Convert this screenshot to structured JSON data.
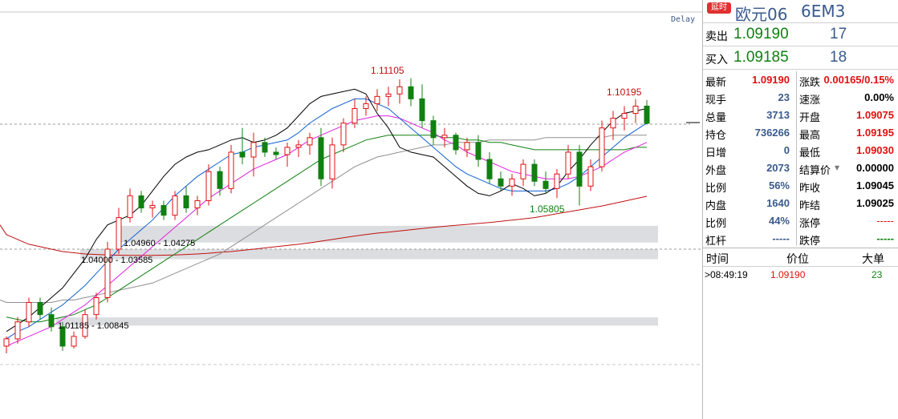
{
  "chart": {
    "delay_label": "Delay",
    "annotations": {
      "high1": "1.11105",
      "high2": "1.10195",
      "low1": "1.05805"
    },
    "zones": [
      {
        "label": "1.04960 - 1.04275",
        "upper": 1.0496,
        "lower": 1.04275
      },
      {
        "label": "1.04000 - 1.03585",
        "upper": 1.04,
        "lower": 1.03585
      },
      {
        "label": "1.01185 - 1.00845",
        "upper": 1.01185,
        "lower": 1.00845
      }
    ],
    "colors": {
      "up": "#e01010",
      "down": "#108010",
      "ma5": "#000000",
      "ma10": "#1060d0",
      "ma20": "#e020e0",
      "ma60": "#108010",
      "ma120": "#909090",
      "ma250": "#c01010"
    }
  },
  "chart_data": {
    "type": "candlestick",
    "price_levels": {
      "last": 1.0919,
      "previous_settle": 1.09025
    },
    "series": [
      {
        "name": "MA5",
        "values": [
          1.006,
          1.009,
          1.012,
          1.016,
          1.02,
          1.024,
          1.03,
          1.036,
          1.044,
          1.05,
          1.052,
          1.054,
          1.058,
          1.064,
          1.07,
          1.075,
          1.078,
          1.08,
          1.081,
          1.083,
          1.085,
          1.086,
          1.084,
          1.085,
          1.087,
          1.09,
          1.095,
          1.1,
          1.103,
          1.104,
          1.105,
          1.106,
          1.104,
          1.096,
          1.09,
          1.082,
          1.08,
          1.079,
          1.078,
          1.074,
          1.07,
          1.066,
          1.063,
          1.062,
          1.064,
          1.067,
          1.065,
          1.062,
          1.063,
          1.066,
          1.072,
          1.077,
          1.083,
          1.088,
          1.093,
          1.096,
          1.097,
          1.098
        ]
      },
      {
        "name": "MA10",
        "values": [
          1.003,
          1.006,
          1.008,
          1.011,
          1.014,
          1.017,
          1.021,
          1.025,
          1.03,
          1.035,
          1.04,
          1.044,
          1.048,
          1.052,
          1.057,
          1.062,
          1.066,
          1.07,
          1.073,
          1.076,
          1.079,
          1.08,
          1.082,
          1.083,
          1.084,
          1.085,
          1.088,
          1.092,
          1.095,
          1.098,
          1.1,
          1.102,
          1.102,
          1.1,
          1.098,
          1.094,
          1.09,
          1.086,
          1.082,
          1.078,
          1.074,
          1.071,
          1.069,
          1.067,
          1.065,
          1.064,
          1.064,
          1.064,
          1.064,
          1.065,
          1.067,
          1.07,
          1.074,
          1.078,
          1.082,
          1.086,
          1.089,
          1.092
        ]
      },
      {
        "name": "MA20",
        "values": [
          1.0,
          1.002,
          1.004,
          1.006,
          1.008,
          1.011,
          1.014,
          1.017,
          1.021,
          1.025,
          1.029,
          1.033,
          1.037,
          1.041,
          1.045,
          1.049,
          1.053,
          1.057,
          1.061,
          1.064,
          1.067,
          1.07,
          1.073,
          1.075,
          1.077,
          1.079,
          1.082,
          1.085,
          1.087,
          1.089,
          1.091,
          1.093,
          1.094,
          1.095,
          1.095,
          1.094,
          1.092,
          1.09,
          1.088,
          1.085,
          1.083,
          1.08,
          1.078,
          1.076,
          1.074,
          1.072,
          1.071,
          1.07,
          1.069,
          1.069,
          1.069,
          1.07,
          1.072,
          1.074,
          1.077,
          1.08,
          1.082,
          1.084
        ]
      },
      {
        "name": "MA60",
        "values": [
          1.012,
          1.011,
          1.01,
          1.01,
          1.011,
          1.012,
          1.013,
          1.015,
          1.017,
          1.02,
          1.023,
          1.026,
          1.029,
          1.032,
          1.035,
          1.038,
          1.041,
          1.044,
          1.047,
          1.05,
          1.053,
          1.056,
          1.059,
          1.062,
          1.065,
          1.068,
          1.071,
          1.074,
          1.077,
          1.079,
          1.081,
          1.083,
          1.085,
          1.086,
          1.087,
          1.087,
          1.087,
          1.087,
          1.087,
          1.086,
          1.086,
          1.085,
          1.085,
          1.084,
          1.084,
          1.083,
          1.082,
          1.081,
          1.081,
          1.081,
          1.081,
          1.081,
          1.081,
          1.081,
          1.081,
          1.081,
          1.082,
          1.082
        ]
      },
      {
        "name": "MA120",
        "values": [
          1.018,
          1.018,
          1.018,
          1.018,
          1.018,
          1.019,
          1.019,
          1.02,
          1.021,
          1.022,
          1.023,
          1.024,
          1.025,
          1.026,
          1.028,
          1.03,
          1.032,
          1.034,
          1.036,
          1.038,
          1.041,
          1.044,
          1.047,
          1.05,
          1.053,
          1.056,
          1.059,
          1.062,
          1.065,
          1.068,
          1.071,
          1.074,
          1.076,
          1.078,
          1.079,
          1.08,
          1.081,
          1.082,
          1.083,
          1.083,
          1.084,
          1.084,
          1.084,
          1.085,
          1.085,
          1.085,
          1.085,
          1.085,
          1.086,
          1.086,
          1.086,
          1.086,
          1.086,
          1.086,
          1.087,
          1.087,
          1.087,
          1.087
        ]
      },
      {
        "name": "MA250",
        "values": [
          1.046,
          1.044,
          1.042,
          1.041,
          1.04,
          1.039,
          1.0385,
          1.038,
          1.0378,
          1.0376,
          1.0375,
          1.0374,
          1.0374,
          1.0374,
          1.0375,
          1.0376,
          1.0378,
          1.038,
          1.0383,
          1.0387,
          1.039,
          1.0395,
          1.04,
          1.0405,
          1.041,
          1.0415,
          1.042,
          1.0426,
          1.0433,
          1.044,
          1.0447,
          1.0454,
          1.046,
          1.0466,
          1.047,
          1.0475,
          1.048,
          1.0485,
          1.049,
          1.0494,
          1.0498,
          1.0502,
          1.0506,
          1.051,
          1.0515,
          1.052,
          1.0525,
          1.053,
          1.0538,
          1.0546,
          1.0554,
          1.0562,
          1.057,
          1.0578,
          1.0588,
          1.0598,
          1.0608,
          1.0618
        ]
      }
    ],
    "candles": [
      {
        "o": 1.0,
        "h": 1.004,
        "l": 0.997,
        "c": 1.003
      },
      {
        "o": 1.003,
        "h": 1.012,
        "l": 1.001,
        "c": 1.01
      },
      {
        "o": 1.01,
        "h": 1.02,
        "l": 1.008,
        "c": 1.018
      },
      {
        "o": 1.018,
        "h": 1.02,
        "l": 1.011,
        "c": 1.013
      },
      {
        "o": 1.013,
        "h": 1.016,
        "l": 1.006,
        "c": 1.008
      },
      {
        "o": 1.008,
        "h": 1.01,
        "l": 0.998,
        "c": 1.0
      },
      {
        "o": 1.0,
        "h": 1.006,
        "l": 0.999,
        "c": 1.004
      },
      {
        "o": 1.004,
        "h": 1.015,
        "l": 1.003,
        "c": 1.013
      },
      {
        "o": 1.013,
        "h": 1.022,
        "l": 1.011,
        "c": 1.02
      },
      {
        "o": 1.02,
        "h": 1.043,
        "l": 1.018,
        "c": 1.04
      },
      {
        "o": 1.04,
        "h": 1.057,
        "l": 1.038,
        "c": 1.053
      },
      {
        "o": 1.053,
        "h": 1.065,
        "l": 1.051,
        "c": 1.062
      },
      {
        "o": 1.062,
        "h": 1.064,
        "l": 1.055,
        "c": 1.057
      },
      {
        "o": 1.057,
        "h": 1.06,
        "l": 1.053,
        "c": 1.058
      },
      {
        "o": 1.058,
        "h": 1.06,
        "l": 1.052,
        "c": 1.054
      },
      {
        "o": 1.054,
        "h": 1.064,
        "l": 1.052,
        "c": 1.062
      },
      {
        "o": 1.062,
        "h": 1.066,
        "l": 1.055,
        "c": 1.057
      },
      {
        "o": 1.057,
        "h": 1.062,
        "l": 1.054,
        "c": 1.06
      },
      {
        "o": 1.06,
        "h": 1.075,
        "l": 1.058,
        "c": 1.072
      },
      {
        "o": 1.072,
        "h": 1.074,
        "l": 1.062,
        "c": 1.065
      },
      {
        "o": 1.065,
        "h": 1.083,
        "l": 1.063,
        "c": 1.08
      },
      {
        "o": 1.08,
        "h": 1.09,
        "l": 1.075,
        "c": 1.078
      },
      {
        "o": 1.078,
        "h": 1.088,
        "l": 1.07,
        "c": 1.084
      },
      {
        "o": 1.084,
        "h": 1.086,
        "l": 1.078,
        "c": 1.08
      },
      {
        "o": 1.08,
        "h": 1.082,
        "l": 1.077,
        "c": 1.079
      },
      {
        "o": 1.079,
        "h": 1.084,
        "l": 1.074,
        "c": 1.082
      },
      {
        "o": 1.082,
        "h": 1.085,
        "l": 1.078,
        "c": 1.083
      },
      {
        "o": 1.083,
        "h": 1.088,
        "l": 1.079,
        "c": 1.086
      },
      {
        "o": 1.086,
        "h": 1.09,
        "l": 1.066,
        "c": 1.069
      },
      {
        "o": 1.069,
        "h": 1.086,
        "l": 1.065,
        "c": 1.083
      },
      {
        "o": 1.083,
        "h": 1.094,
        "l": 1.08,
        "c": 1.092
      },
      {
        "o": 1.092,
        "h": 1.102,
        "l": 1.09,
        "c": 1.098
      },
      {
        "o": 1.098,
        "h": 1.103,
        "l": 1.095,
        "c": 1.1
      },
      {
        "o": 1.1,
        "h": 1.106,
        "l": 1.097,
        "c": 1.103
      },
      {
        "o": 1.103,
        "h": 1.107,
        "l": 1.099,
        "c": 1.104
      },
      {
        "o": 1.104,
        "h": 1.11,
        "l": 1.1,
        "c": 1.107
      },
      {
        "o": 1.107,
        "h": 1.1105,
        "l": 1.099,
        "c": 1.102
      },
      {
        "o": 1.102,
        "h": 1.108,
        "l": 1.09,
        "c": 1.093
      },
      {
        "o": 1.093,
        "h": 1.095,
        "l": 1.083,
        "c": 1.086
      },
      {
        "o": 1.086,
        "h": 1.09,
        "l": 1.082,
        "c": 1.087
      },
      {
        "o": 1.087,
        "h": 1.088,
        "l": 1.079,
        "c": 1.081
      },
      {
        "o": 1.081,
        "h": 1.086,
        "l": 1.078,
        "c": 1.084
      },
      {
        "o": 1.084,
        "h": 1.087,
        "l": 1.074,
        "c": 1.077
      },
      {
        "o": 1.077,
        "h": 1.08,
        "l": 1.067,
        "c": 1.069
      },
      {
        "o": 1.069,
        "h": 1.072,
        "l": 1.064,
        "c": 1.066
      },
      {
        "o": 1.066,
        "h": 1.071,
        "l": 1.062,
        "c": 1.069
      },
      {
        "o": 1.069,
        "h": 1.077,
        "l": 1.066,
        "c": 1.075
      },
      {
        "o": 1.075,
        "h": 1.077,
        "l": 1.066,
        "c": 1.068
      },
      {
        "o": 1.068,
        "h": 1.072,
        "l": 1.063,
        "c": 1.065
      },
      {
        "o": 1.065,
        "h": 1.073,
        "l": 1.061,
        "c": 1.071
      },
      {
        "o": 1.071,
        "h": 1.083,
        "l": 1.069,
        "c": 1.08
      },
      {
        "o": 1.08,
        "h": 1.083,
        "l": 1.058,
        "c": 1.066
      },
      {
        "o": 1.066,
        "h": 1.077,
        "l": 1.064,
        "c": 1.074
      },
      {
        "o": 1.074,
        "h": 1.093,
        "l": 1.072,
        "c": 1.09
      },
      {
        "o": 1.09,
        "h": 1.097,
        "l": 1.085,
        "c": 1.094
      },
      {
        "o": 1.094,
        "h": 1.099,
        "l": 1.089,
        "c": 1.096
      },
      {
        "o": 1.096,
        "h": 1.1019,
        "l": 1.092,
        "c": 1.099
      },
      {
        "o": 1.099,
        "h": 1.1015,
        "l": 1.0915,
        "c": 1.0919
      }
    ]
  },
  "panel": {
    "badge": "延时",
    "name": "欧元06",
    "code": "6EM3",
    "ask": {
      "label": "卖出",
      "price": "1.09190",
      "vol": "17"
    },
    "bid": {
      "label": "买入",
      "price": "1.09185",
      "vol": "18"
    },
    "stats": [
      {
        "l1": "最新",
        "v1": "1.09190",
        "c1": "red",
        "l2": "涨跌",
        "v2": "0.00165/0.15%",
        "c2": "red"
      },
      {
        "l1": "现手",
        "v1": "23",
        "c1": "blue",
        "l2": "速涨",
        "v2": "0.00%",
        "c2": "black"
      },
      {
        "l1": "总量",
        "v1": "3713",
        "c1": "blue",
        "l2": "开盘",
        "v2": "1.09075",
        "c2": "red"
      },
      {
        "l1": "持仓",
        "v1": "736266",
        "c1": "blue",
        "l2": "最高",
        "v2": "1.09195",
        "c2": "red"
      },
      {
        "l1": "日增",
        "v1": "0",
        "c1": "blue",
        "l2": "最低",
        "v2": "1.09030",
        "c2": "red"
      },
      {
        "l1": "外盘",
        "v1": "2073",
        "c1": "blue",
        "l2": "结算价",
        "v2": "0.00000",
        "c2": "black"
      },
      {
        "l1": "比例",
        "v1": "56%",
        "c1": "blue",
        "l2": "昨收",
        "v2": "1.09045",
        "c2": "black"
      },
      {
        "l1": "内盘",
        "v1": "1640",
        "c1": "blue",
        "l2": "昨结",
        "v2": "1.09025",
        "c2": "black"
      },
      {
        "l1": "比例",
        "v1": "44%",
        "c1": "blue",
        "l2": "涨停",
        "v2": "-----",
        "c2": "dash"
      },
      {
        "l1": "杠杆",
        "v1": "-----",
        "c1": "blue",
        "l2": "跌停",
        "v2": "-----",
        "c2": "green"
      }
    ],
    "ticks_header": {
      "time": "时间",
      "price": "价位",
      "size": "大单"
    },
    "ticks": [
      {
        "time": ">08:49:19",
        "price": "1.09190",
        "size": "23"
      }
    ]
  }
}
